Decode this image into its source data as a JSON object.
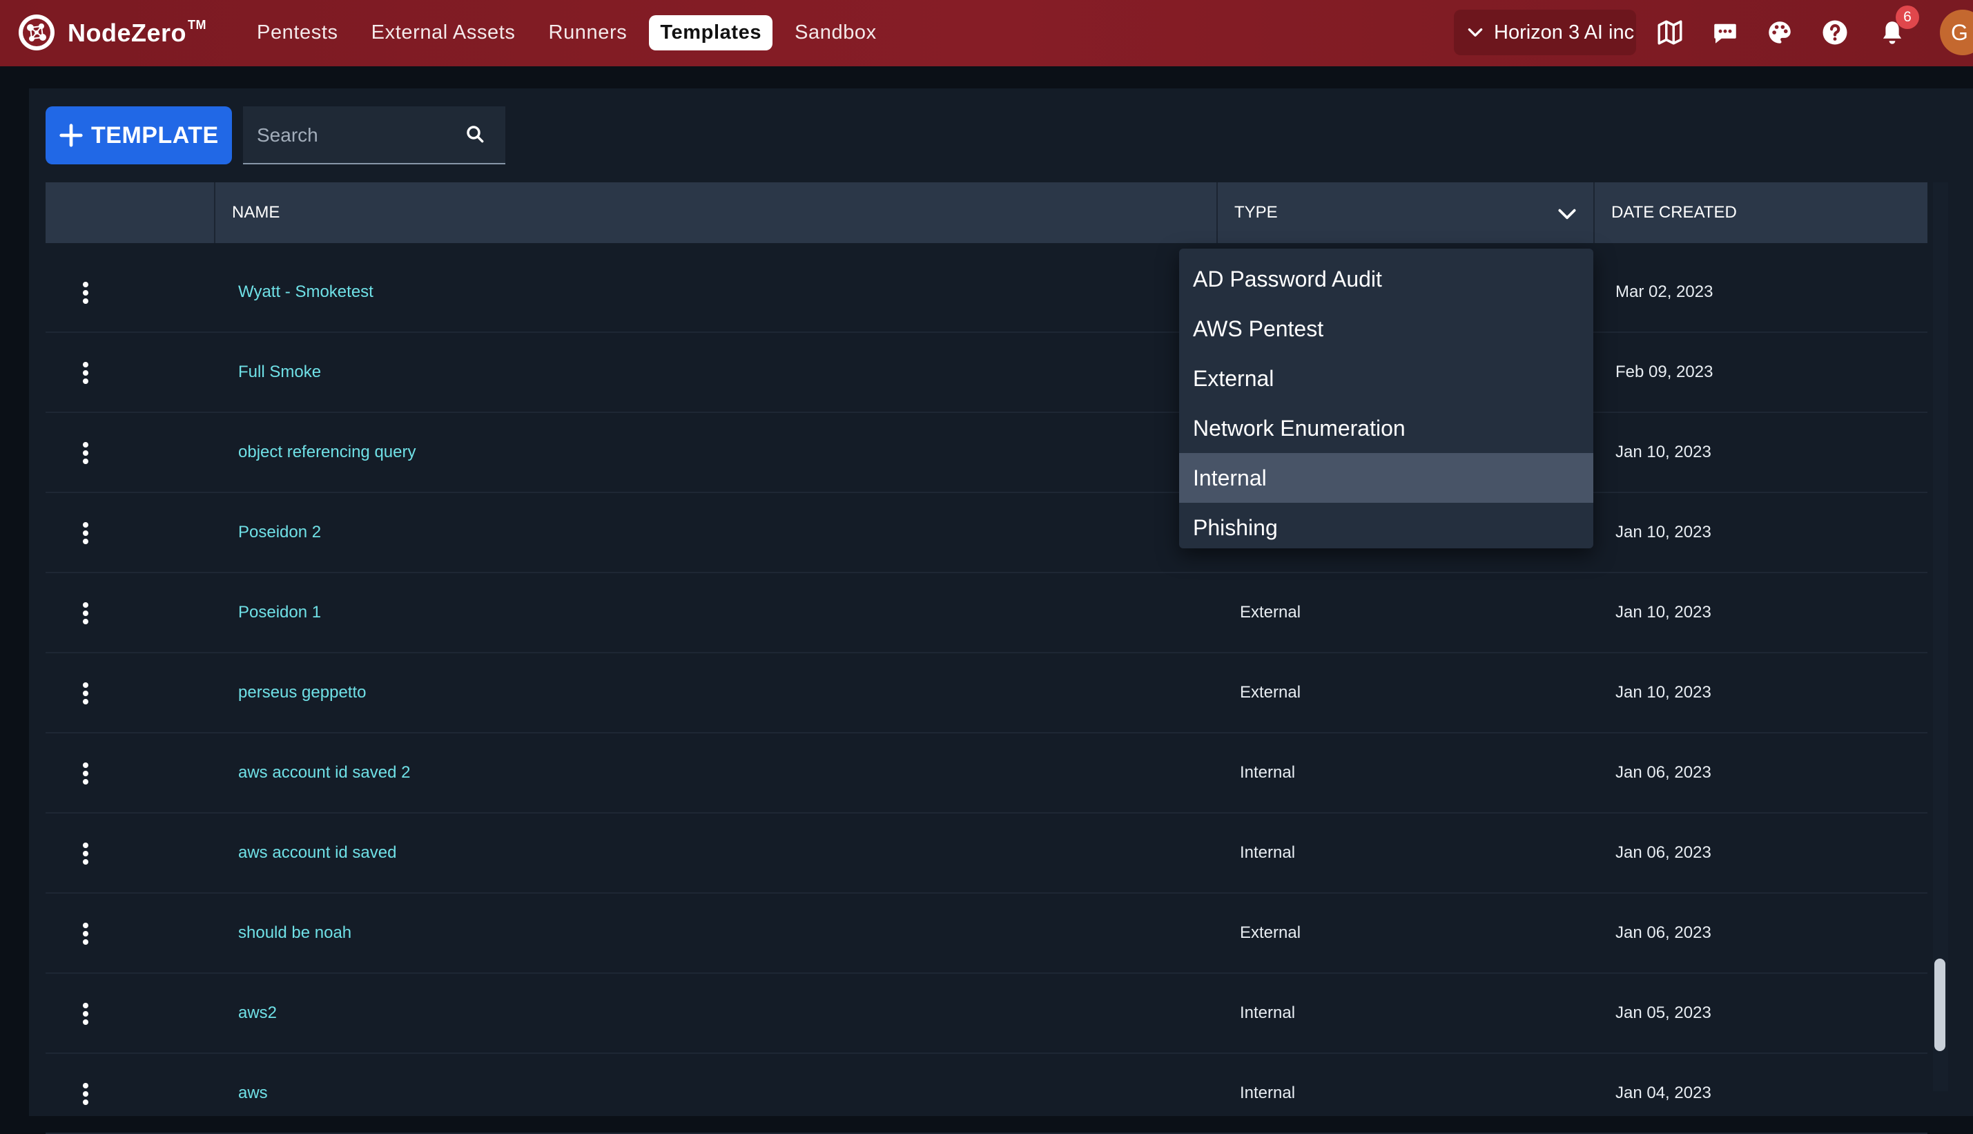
{
  "app": {
    "name": "NodeZero",
    "trademark": "TM"
  },
  "nav": {
    "items": [
      {
        "label": "Pentests"
      },
      {
        "label": "External Assets"
      },
      {
        "label": "Runners"
      },
      {
        "label": "Templates",
        "active": true
      },
      {
        "label": "Sandbox"
      }
    ]
  },
  "header": {
    "org": "Horizon 3 AI inc",
    "notification_count": "6",
    "avatar_initial": "G",
    "icons": [
      "chevron-down-icon",
      "map-icon",
      "chat-icon",
      "palette-icon",
      "help-icon",
      "bell-icon"
    ]
  },
  "toolbar": {
    "add_label": "TEMPLATE",
    "search_placeholder": "Search"
  },
  "table": {
    "columns": {
      "name": "NAME",
      "type": "TYPE",
      "date": "DATE CREATED"
    },
    "rows": [
      {
        "name": "Wyatt - Smoketest",
        "type": "",
        "date": "Mar 02, 2023"
      },
      {
        "name": "Full Smoke",
        "type": "",
        "date": "Feb 09, 2023"
      },
      {
        "name": "object referencing query",
        "type": "",
        "date": "Jan 10, 2023"
      },
      {
        "name": "Poseidon 2",
        "type": "",
        "date": "Jan 10, 2023"
      },
      {
        "name": "Poseidon 1",
        "type": "External",
        "date": "Jan 10, 2023"
      },
      {
        "name": "perseus geppetto",
        "type": "External",
        "date": "Jan 10, 2023"
      },
      {
        "name": "aws account id saved 2",
        "type": "Internal",
        "date": "Jan 06, 2023"
      },
      {
        "name": "aws account id saved",
        "type": "Internal",
        "date": "Jan 06, 2023"
      },
      {
        "name": "should be noah",
        "type": "External",
        "date": "Jan 06, 2023"
      },
      {
        "name": "aws2",
        "type": "Internal",
        "date": "Jan 05, 2023"
      },
      {
        "name": "aws",
        "type": "Internal",
        "date": "Jan 04, 2023"
      }
    ]
  },
  "type_dropdown": {
    "options": [
      {
        "label": "AD Password Audit"
      },
      {
        "label": "AWS Pentest"
      },
      {
        "label": "External"
      },
      {
        "label": "Network Enumeration"
      },
      {
        "label": "Internal",
        "highlighted": true
      },
      {
        "label": "Phishing"
      }
    ]
  },
  "colors": {
    "topbar": "#861d26",
    "accent_button": "#2168e6",
    "link_text": "#6fe0e6",
    "panel": "#141c27"
  }
}
